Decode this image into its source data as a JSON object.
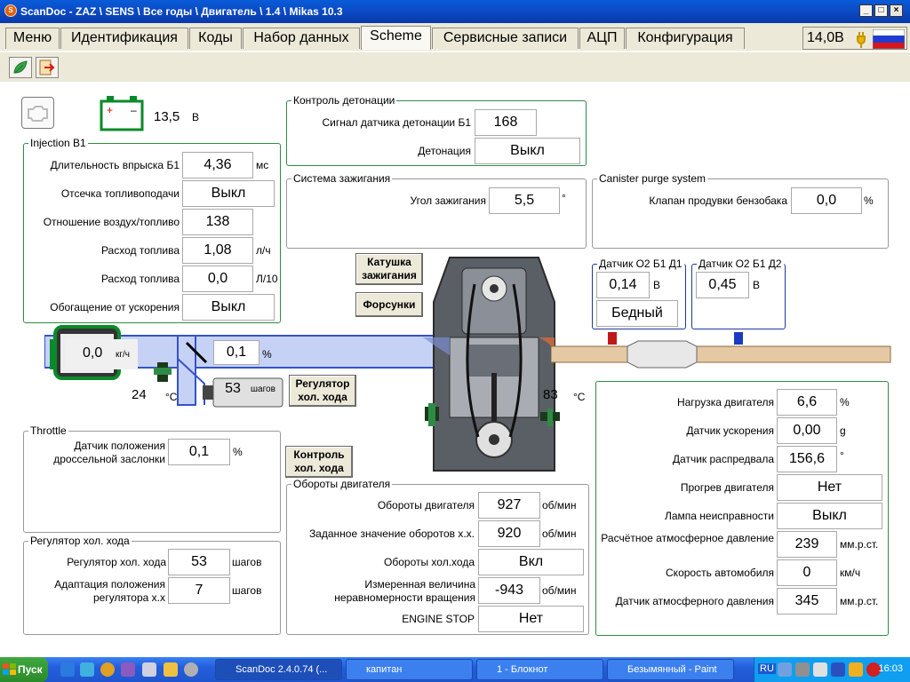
{
  "window": {
    "title": "ScanDoc - ZAZ \\ SENS \\ Все годы \\ Двигатель \\ 1.4 \\ Mikas 10.3"
  },
  "tabs": [
    "Меню",
    "Идентификация",
    "Коды",
    "Набор данных",
    "Scheme",
    "Сервисные записи",
    "АЦП",
    "Конфигурация"
  ],
  "active_tab": "Scheme",
  "voltage": "14,0В",
  "battery": {
    "value": "13,5",
    "unit": "В"
  },
  "injection": {
    "title": "Injection B1",
    "rows": [
      {
        "label": "Длительность впрыска Б1",
        "value": "4,36",
        "unit": "мс"
      },
      {
        "label": "Отсечка топливоподачи",
        "value": "Выкл",
        "unit": ""
      },
      {
        "label": "Отношение воздух/топливо",
        "value": "138",
        "unit": ""
      },
      {
        "label": "Расход топлива",
        "value": "1,08",
        "unit": "л/ч"
      },
      {
        "label": "Расход топлива",
        "value": "0,0",
        "unit": "Л/10"
      },
      {
        "label": "Обогащение от ускорения",
        "value": "Выкл",
        "unit": ""
      }
    ]
  },
  "knock": {
    "title": "Контроль детонации",
    "rows": [
      {
        "label": "Сигнал датчика детонации Б1",
        "value": "168"
      },
      {
        "label": "Детонация",
        "value": "Выкл"
      }
    ]
  },
  "ignition": {
    "title": "Система зажигания",
    "label": "Угол зажигания",
    "value": "5,5",
    "unit": "°"
  },
  "canister": {
    "title": "Canister purge system",
    "label": "Клапан продувки бензобака",
    "value": "0,0",
    "unit": "%"
  },
  "buttons": {
    "coil": "Катушка зажигания",
    "injectors": "Форсунки",
    "idle_reg": "Регулятор хол. хода",
    "idle_ctrl": "Контроль хол. хода"
  },
  "o2_1": {
    "title": "Датчик О2 Б1 Д1",
    "value": "0,14",
    "unit": "В",
    "status": "Бедный"
  },
  "o2_2": {
    "title": "Датчик О2 Б1 Д2",
    "value": "0,45",
    "unit": "В"
  },
  "intake": {
    "maf_value": "0,0",
    "maf_unit": "кг/ч",
    "throttle_value": "0,1",
    "throttle_unit": "%",
    "iac_value": "53",
    "iac_unit": "шагов",
    "air_temp": "24",
    "air_temp_unit": "°C",
    "coolant_temp": "83",
    "coolant_temp_unit": "°C"
  },
  "throttle": {
    "title": "Throttle",
    "label": "Датчик положения дроссельной заслонки",
    "value": "0,1",
    "unit": "%"
  },
  "idle": {
    "title": "Регулятор хол. хода",
    "rows": [
      {
        "label": "Регулятор хол. хода",
        "value": "53",
        "unit": "шагов"
      },
      {
        "label": "Адаптация положения регулятора х.х",
        "value": "7",
        "unit": "шагов"
      }
    ]
  },
  "rpm": {
    "title": "Обороты двигателя",
    "rows": [
      {
        "label": "Обороты двигателя",
        "value": "927",
        "unit": "об/мин"
      },
      {
        "label": "Заданное значение оборотов х.х.",
        "value": "920",
        "unit": "об/мин"
      },
      {
        "label": "Обороты хол.хода",
        "value": "Вкл",
        "unit": ""
      },
      {
        "label": "Измеренная величина неравномерности вращения",
        "value": "-943",
        "unit": "об/мин"
      },
      {
        "label": "ENGINE STOP",
        "value": "Нет",
        "unit": ""
      }
    ]
  },
  "engine": {
    "rows": [
      {
        "label": "Нагрузка двигателя",
        "value": "6,6",
        "unit": "%"
      },
      {
        "label": "Датчик ускорения",
        "value": "0,00",
        "unit": "g"
      },
      {
        "label": "Датчик распредвала",
        "value": "156,6",
        "unit": "°"
      },
      {
        "label": "Прогрев двигателя",
        "value": "Нет",
        "unit": ""
      },
      {
        "label": "Лампа неисправности",
        "value": "Выкл",
        "unit": ""
      },
      {
        "label": "Расчётное атмосферное давление",
        "value": "239",
        "unit": "мм.р.ст."
      },
      {
        "label": "Скорость автомобиля",
        "value": "0",
        "unit": "км/ч"
      },
      {
        "label": "Датчик атмосферного давления",
        "value": "345",
        "unit": "мм.р.ст."
      }
    ]
  },
  "taskbar": {
    "start": "Пуск",
    "tasks": [
      "ScanDoc 2.4.0.74 (...",
      "капитан",
      "1 - Блокнот",
      "Безымянный - Paint"
    ],
    "lang": "RU",
    "clock": "16:03"
  },
  "colors": {
    "group_border": "#2e8b46",
    "pipe_intake": "#c6d2f5",
    "pipe_exhaust": "#e5c9a4",
    "titlebar": "#0b46c0"
  }
}
